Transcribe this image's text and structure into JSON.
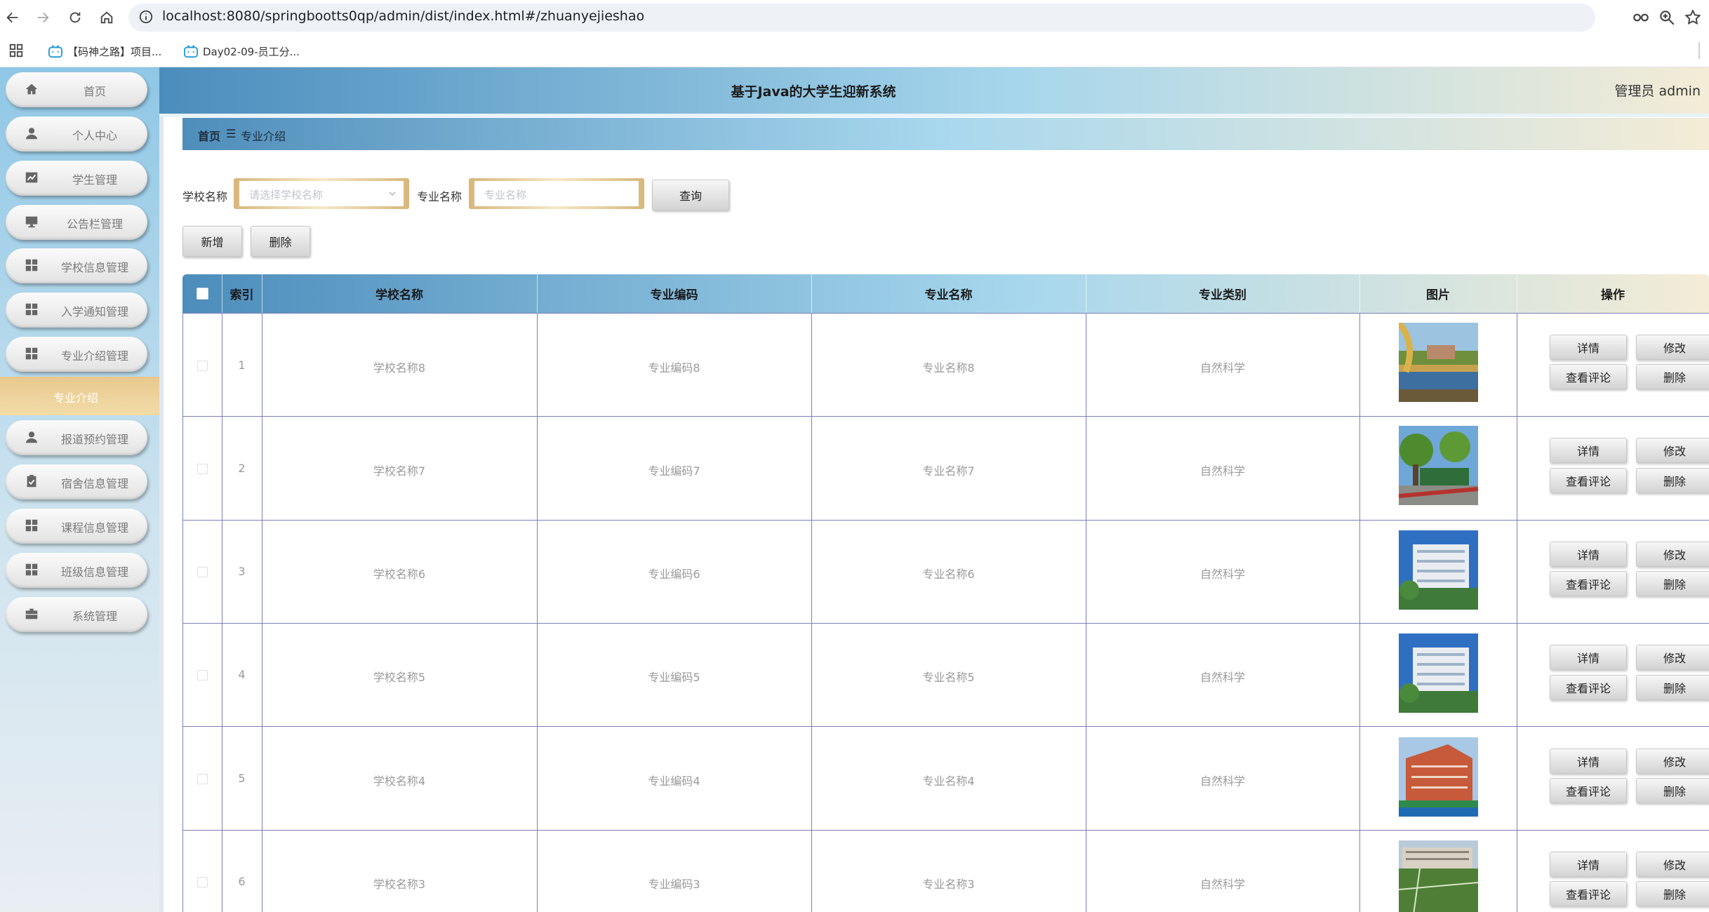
{
  "browser": {
    "url": "localhost:8080/springbootts0qp/admin/dist/index.html#/zhuanyejieshao",
    "bookmarks": [
      "【码神之路】项目...",
      "Day02-09-员工分..."
    ]
  },
  "header": {
    "title": "基于Java的大学生迎新系统",
    "user": "管理员 admin"
  },
  "sidebar": {
    "items": [
      {
        "label": "首页",
        "icon": "home-icon"
      },
      {
        "label": "个人中心",
        "icon": "user-icon"
      },
      {
        "label": "学生管理",
        "icon": "chart-icon"
      },
      {
        "label": "公告栏管理",
        "icon": "monitor-icon"
      },
      {
        "label": "学校信息管理",
        "icon": "grid-icon"
      },
      {
        "label": "入学通知管理",
        "icon": "grid-icon"
      },
      {
        "label": "专业介绍管理",
        "icon": "grid-icon"
      },
      {
        "label": "报道预约管理",
        "icon": "user-icon"
      },
      {
        "label": "宿舍信息管理",
        "icon": "clipboard-icon"
      },
      {
        "label": "课程信息管理",
        "icon": "grid-icon"
      },
      {
        "label": "班级信息管理",
        "icon": "grid-icon"
      },
      {
        "label": "系统管理",
        "icon": "briefcase-icon"
      }
    ],
    "active_sub": "专业介绍"
  },
  "breadcrumb": {
    "home": "首页",
    "separator": "☰",
    "current": "专业介绍"
  },
  "search": {
    "school_label": "学校名称",
    "school_placeholder": "请选择学校名称",
    "major_label": "专业名称",
    "major_placeholder": "专业名称",
    "query_button": "查询"
  },
  "actions": {
    "add": "新增",
    "delete": "删除"
  },
  "table": {
    "columns": [
      "索引",
      "学校名称",
      "专业编码",
      "专业名称",
      "专业类别",
      "图片",
      "操作"
    ],
    "rows": [
      {
        "index": "1",
        "school": "学校名称8",
        "code": "专业编码8",
        "name": "专业名称8",
        "category": "自然科学",
        "image": "lake-campus-photo"
      },
      {
        "index": "2",
        "school": "学校名称7",
        "code": "专业编码7",
        "name": "专业名称7",
        "category": "自然科学",
        "image": "tree-lined-road-photo"
      },
      {
        "index": "3",
        "school": "学校名称6",
        "code": "专业编码6",
        "name": "专业名称6",
        "category": "自然科学",
        "image": "white-building-photo"
      },
      {
        "index": "4",
        "school": "学校名称5",
        "code": "专业编码5",
        "name": "专业名称5",
        "category": "自然科学",
        "image": "white-building-photo"
      },
      {
        "index": "5",
        "school": "学校名称4",
        "code": "专业编码4",
        "name": "专业名称4",
        "category": "自然科学",
        "image": "red-building-photo"
      },
      {
        "index": "6",
        "school": "学校名称3",
        "code": "专业编码3",
        "name": "专业名称3",
        "category": "自然科学",
        "image": "sports-field-photo"
      }
    ],
    "row_actions": {
      "detail": "详情",
      "edit": "修改",
      "comments": "查看评论",
      "delete": "删除"
    }
  },
  "colors": {
    "header_gradient": [
      "#4b8dbd",
      "#a6d6ec",
      "#f4ecd6"
    ],
    "active_menu": "#e8c88e",
    "grid_line": "#7d7fb8"
  }
}
